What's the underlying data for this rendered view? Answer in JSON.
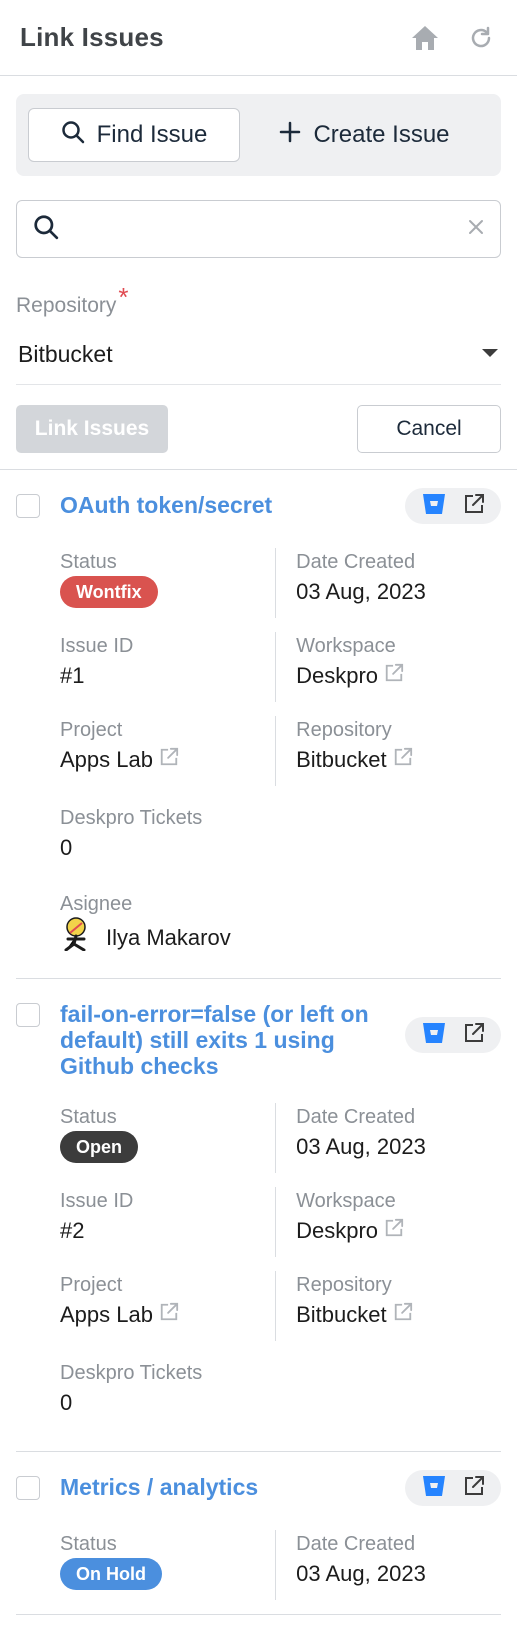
{
  "header": {
    "title": "Link Issues"
  },
  "tabs": {
    "find": "Find Issue",
    "create": "Create Issue"
  },
  "search": {
    "placeholder": ""
  },
  "form": {
    "repository_label": "Repository",
    "required_mark": "*",
    "repository_value": "Bitbucket",
    "link_button": "Link Issues",
    "cancel_button": "Cancel"
  },
  "labels": {
    "status": "Status",
    "date_created": "Date Created",
    "issue_id": "Issue ID",
    "workspace": "Workspace",
    "project": "Project",
    "repository": "Repository",
    "deskpro_tickets": "Deskpro Tickets",
    "assignee": "Asignee"
  },
  "issues": [
    {
      "title": "OAuth token/secret",
      "status": "Wontfix",
      "status_color": "#d9534f",
      "date_created": "03 Aug, 2023",
      "issue_id": "#1",
      "workspace": "Deskpro",
      "project": "Apps Lab",
      "repository": "Bitbucket",
      "deskpro_tickets": "0",
      "assignee": "Ilya Makarov"
    },
    {
      "title": "fail-on-error=false (or left on default) still exits 1 using Github checks",
      "status": "Open",
      "status_color": "#3c3c3c",
      "date_created": "03 Aug, 2023",
      "issue_id": "#2",
      "workspace": "Deskpro",
      "project": "Apps Lab",
      "repository": "Bitbucket",
      "deskpro_tickets": "0"
    },
    {
      "title": "Metrics / analytics",
      "status": "On Hold",
      "status_color": "#4b8fde",
      "date_created": "03 Aug, 2023"
    }
  ],
  "colors": {
    "accent": "#4b8fde",
    "bitbucket": "#2684ff"
  }
}
